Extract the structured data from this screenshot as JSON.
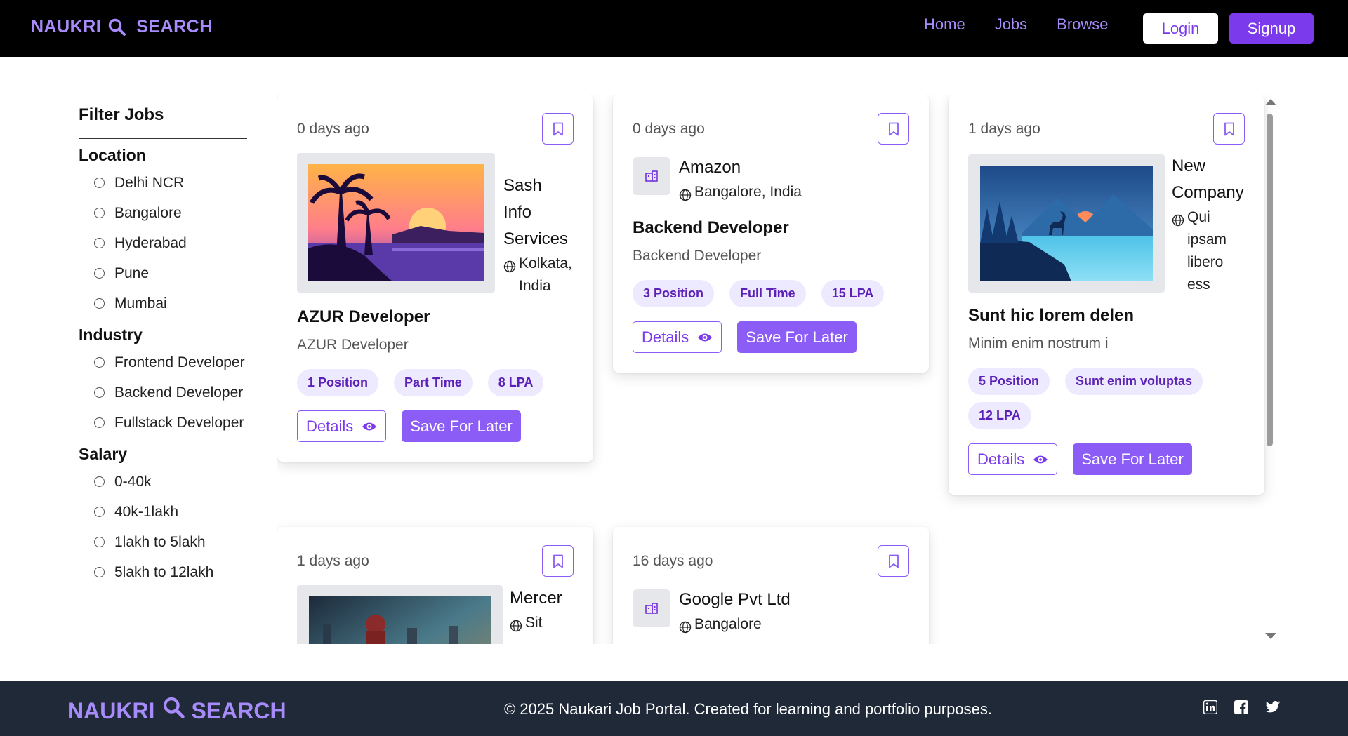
{
  "navbar": {
    "brand_left": "NAUKRI",
    "brand_right": "SEARCH",
    "links": [
      "Home",
      "Jobs",
      "Browse"
    ],
    "login": "Login",
    "signup": "Signup"
  },
  "filter": {
    "title": "Filter Jobs",
    "groups": [
      {
        "title": "Location",
        "options": [
          "Delhi NCR",
          "Bangalore",
          "Hyderabad",
          "Pune",
          "Mumbai"
        ]
      },
      {
        "title": "Industry",
        "options": [
          "Frontend Developer",
          "Backend Developer",
          "Fullstack Developer"
        ]
      },
      {
        "title": "Salary",
        "options": [
          "0-40k",
          "40k-1lakh",
          "1lakh to 5lakh",
          "5lakh to 12lakh"
        ]
      }
    ]
  },
  "jobs": [
    {
      "ago": "0 days ago",
      "company": "Sash Info Services",
      "location": "Kolkata, India",
      "title": "AZUR Developer",
      "desc": "AZUR Developer",
      "tags": [
        "1 Position",
        "Part Time",
        "8 LPA"
      ],
      "details": "Details",
      "save": "Save For Later"
    },
    {
      "ago": "0 days ago",
      "company": "Amazon",
      "location": "Bangalore, India",
      "title": "Backend Developer",
      "desc": "Backend Developer",
      "tags": [
        "3 Position",
        "Full Time",
        "15 LPA"
      ],
      "details": "Details",
      "save": "Save For Later"
    },
    {
      "ago": "1 days ago",
      "company": "New Company",
      "location": "Qui ipsam libero ess",
      "title": "Sunt hic lorem delen",
      "desc": "Minim enim nostrum i",
      "tags": [
        "5 Position",
        "Sunt enim voluptas",
        "12 LPA"
      ],
      "details": "Details",
      "save": "Save For Later"
    },
    {
      "ago": "1 days ago",
      "company": "Mercer",
      "location": "Sit"
    },
    {
      "ago": "16 days ago",
      "company": "Google Pvt Ltd",
      "location": "Bangalore"
    }
  ],
  "footer": {
    "brand_left": "NAUKRI",
    "brand_right": "SEARCH",
    "copyright": "© 2025 Naukari Job Portal. Created for learning and portfolio purposes."
  },
  "icons": [
    "search-icon",
    "bookmark-icon",
    "globe-icon",
    "building-icon",
    "eye-icon",
    "linkedin-icon",
    "facebook-icon",
    "twitter-icon"
  ],
  "colors": {
    "accent": "#8b5cf6",
    "brand": "#a78bfa",
    "navbar": "#000000",
    "footer": "#1f2937",
    "tag_bg": "#ede9fe"
  }
}
